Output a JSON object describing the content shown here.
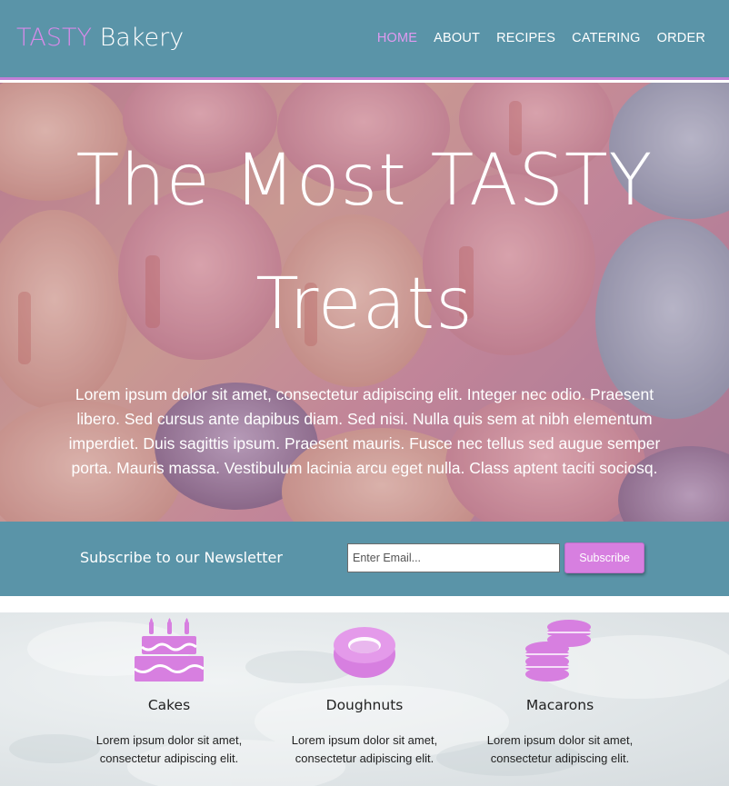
{
  "header": {
    "brand_accent": "TASTY",
    "brand_rest": "Bakery",
    "nav": [
      {
        "label": "HOME",
        "active": true
      },
      {
        "label": "ABOUT",
        "active": false
      },
      {
        "label": "RECIPES",
        "active": false
      },
      {
        "label": "CATERING",
        "active": false
      },
      {
        "label": "ORDER",
        "active": false
      }
    ]
  },
  "hero": {
    "title_line1": "The Most TASTY",
    "title_line2": "Treats",
    "body": "Lorem ipsum dolor sit amet, consectetur adipiscing elit. Integer nec odio. Praesent libero. Sed cursus ante dapibus diam. Sed nisi. Nulla quis sem at nibh elementum imperdiet. Duis sagittis ipsum. Praesent mauris. Fusce nec tellus sed augue semper porta. Mauris massa. Vestibulum lacinia arcu eget nulla. Class aptent taciti sociosq."
  },
  "newsletter": {
    "label": "Subscribe to our Newsletter",
    "email_placeholder": "Enter Email...",
    "email_value": "",
    "button_label": "Subscribe"
  },
  "products": [
    {
      "icon": "cake-icon",
      "name": "Cakes",
      "desc": "Lorem ipsum dolor sit amet, consectetur adipiscing elit."
    },
    {
      "icon": "doughnut-icon",
      "name": "Doughnuts",
      "desc": "Lorem ipsum dolor sit amet, consectetur adipiscing elit."
    },
    {
      "icon": "macarons-icon",
      "name": "Macarons",
      "desc": "Lorem ipsum dolor sit amet, consectetur adipiscing elit."
    }
  ],
  "colors": {
    "primary": "#5a94a8",
    "accent": "#d77fe0",
    "white": "#ffffff"
  }
}
